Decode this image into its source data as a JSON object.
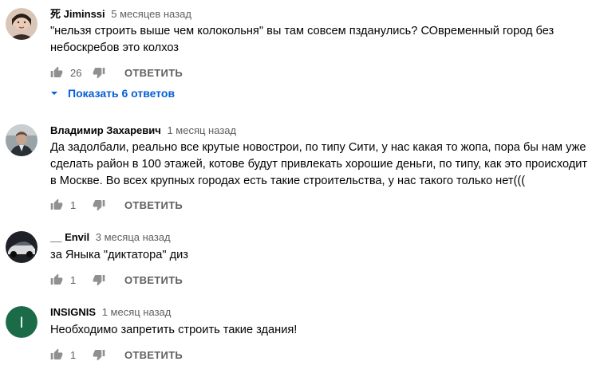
{
  "comments": [
    {
      "author": "死 Jiminssi",
      "time": "5 месяцев назад",
      "text": "\"нельзя строить выше чем колокольня\" вы там совсем пзданулись? СОвременный город без небоскребов это колхоз",
      "likes": "26",
      "reply_label": "ОТВЕТИТЬ",
      "show_replies_label": "Показать 6 ответов"
    },
    {
      "author": "Владимир Захаревич",
      "time": "1 месяц назад",
      "text": "Да задолбали, реально все крутые новострои, по типу Сити, у нас какая то жопа, пора бы нам уже сделать район в 100 этажей, котове будут привлекать хорошие деньги, по типу, как это происходит в Москве. Во всех крупных городах есть такие строительства, у нас такого только нет(((",
      "likes": "1",
      "reply_label": "ОТВЕТИТЬ"
    },
    {
      "author": "__ Envil",
      "time": "3 месяца назад",
      "text": "за Яныка \"диктатора\" диз",
      "likes": "1",
      "reply_label": "ОТВЕТИТЬ"
    },
    {
      "author": "INSIGNIS",
      "time": "1 месяц назад",
      "text": "Необходимо запретить строить такие здания!",
      "likes": "1",
      "reply_label": "ОТВЕТИТЬ",
      "avatar_letter": "I",
      "avatar_color": "#1b6b48"
    }
  ],
  "icons": {
    "like": "thumb-up-icon",
    "dislike": "thumb-down-icon",
    "expand": "caret-down-icon"
  },
  "colors": {
    "link": "#065fd4",
    "muted": "#606060",
    "icon": "#909090"
  }
}
